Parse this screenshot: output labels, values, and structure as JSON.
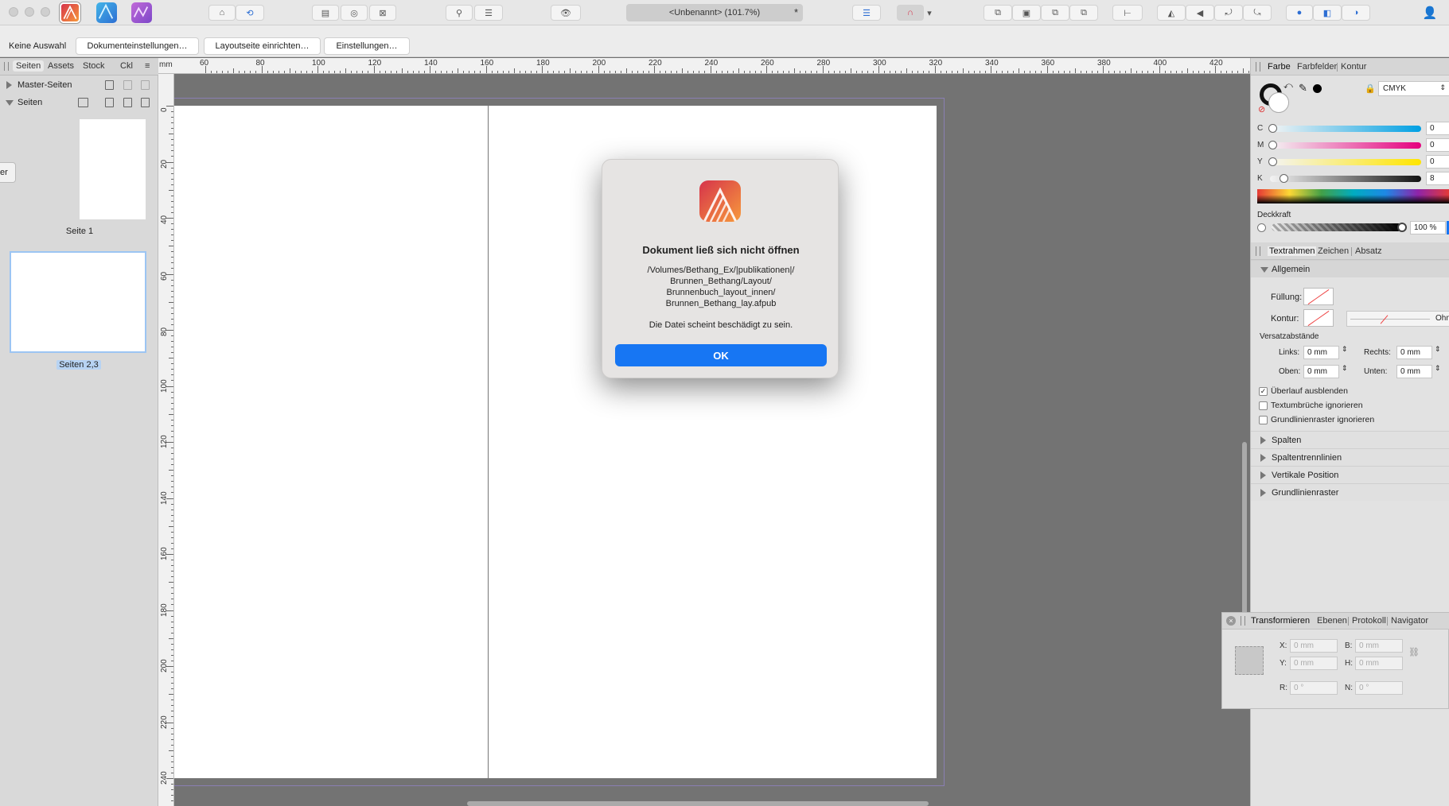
{
  "toolbar": {
    "document_title": "<Unbenannt> (101.7%)",
    "modified_marker": "*"
  },
  "context_bar": {
    "selection_label": "Keine Auswahl",
    "buttons": [
      "Dokumenteinstellungen…",
      "Layoutseite einrichten…",
      "Einstellungen…"
    ]
  },
  "left_panel": {
    "tabs": [
      "Seiten",
      "Assets",
      "Stock",
      "Ckl"
    ],
    "master_pages_label": "Master-Seiten",
    "pages_label": "Seiten",
    "thumb_labels": [
      "Seite 1",
      "Seiten 2,3"
    ],
    "partial_button_text": "er"
  },
  "ruler": {
    "unit": "mm",
    "h_ticks": [
      "60",
      "80",
      "100",
      "120",
      "140",
      "160",
      "180",
      "200",
      "220",
      "240",
      "260",
      "280",
      "300",
      "320",
      "340",
      "360",
      "380",
      "400",
      "420"
    ],
    "v_ticks": [
      "0",
      "20",
      "40",
      "60",
      "80",
      "100",
      "120",
      "140",
      "160",
      "180",
      "200",
      "220",
      "240"
    ]
  },
  "color_panel": {
    "tabs": [
      "Farbe",
      "Farbfelder",
      "Kontur"
    ],
    "model": "CMYK",
    "channels": [
      {
        "label": "C",
        "value": "0",
        "level": 0
      },
      {
        "label": "M",
        "value": "0",
        "level": 0
      },
      {
        "label": "Y",
        "value": "0",
        "level": 0
      },
      {
        "label": "K",
        "value": "8",
        "level": 0.08
      }
    ],
    "opacity_label": "Deckkraft",
    "opacity_value": "100 %"
  },
  "textframe_panel": {
    "tabs": [
      "Textrahmen",
      "Zeichen",
      "Absatz"
    ],
    "section_general": "Allgemein",
    "fill_label": "Füllung:",
    "stroke_label": "Kontur:",
    "stroke_none": "Ohn",
    "inset_title": "Versatzabstände",
    "left_label": "Links:",
    "left_value": "0 mm",
    "right_label": "Rechts:",
    "right_value": "0 mm",
    "top_label": "Oben:",
    "top_value": "0 mm",
    "bottom_label": "Unten:",
    "bottom_value": "0 mm",
    "checkboxes": [
      {
        "label": "Überlauf ausblenden",
        "checked": true
      },
      {
        "label": "Textumbrüche ignorieren",
        "checked": false
      },
      {
        "label": "Grundlinienraster ignorieren",
        "checked": false
      }
    ],
    "sections": [
      "Spalten",
      "Spaltentrennlinien",
      "Vertikale Position",
      "Grundlinienraster"
    ]
  },
  "transform_panel": {
    "tabs": [
      "Transformieren",
      "Ebenen",
      "Protokoll",
      "Navigator"
    ],
    "x_label": "X:",
    "x_placeholder": "0 mm",
    "y_label": "Y:",
    "y_placeholder": "0 mm",
    "w_label": "B:",
    "w_placeholder": "0 mm",
    "h_label": "H:",
    "h_placeholder": "0 mm",
    "r_label": "R:",
    "r_placeholder": "0 °",
    "s_label": "N:",
    "s_placeholder": "0 °"
  },
  "dialog": {
    "title": "Dokument ließ sich nicht öffnen",
    "path_lines": [
      "/Volumes/Bethang_Ex/|publikationen|/",
      "Brunnen_Bethang/Layout/",
      "Brunnenbuch_layout_innen/",
      "Brunnen_Bethang_lay.afpub"
    ],
    "message": "Die Datei scheint beschädigt zu sein.",
    "ok_label": "OK"
  },
  "colors": {
    "accent": "#1776f3",
    "app_icon_orange": "#f47b3b",
    "app_icon_red": "#d6334b"
  }
}
